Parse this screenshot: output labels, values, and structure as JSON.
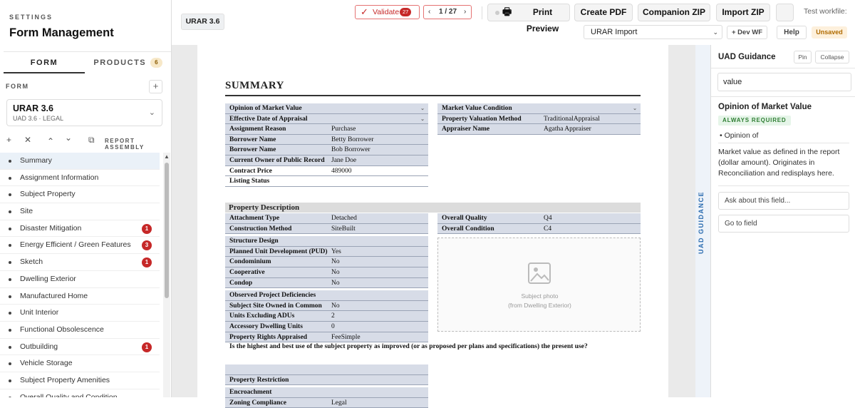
{
  "sidebar": {
    "settings_label": "SETTINGS",
    "title": "Form Management",
    "tabs": [
      {
        "label": "FORM"
      },
      {
        "label": "PRODUCTS",
        "count": "6"
      }
    ],
    "form_label": "FORM",
    "add_icon": "+",
    "form_select": {
      "name": "URAR 3.6",
      "sub": "UAD 3.6 · LEGAL",
      "chevron": "⌄"
    },
    "toolbar": {
      "add": "+",
      "remove": "✕",
      "up": "⌃",
      "down": "⌄",
      "copy": "⧉",
      "report_label": "REPORT ASSEMBLY"
    },
    "scroll_up": "▲",
    "items": [
      {
        "label": "Summary",
        "badge": ""
      },
      {
        "label": "Assignment Information",
        "badge": ""
      },
      {
        "label": "Subject Property",
        "badge": ""
      },
      {
        "label": "Site",
        "badge": ""
      },
      {
        "label": "Disaster Mitigation",
        "badge": "1"
      },
      {
        "label": "Energy Efficient / Green Features",
        "badge": "3"
      },
      {
        "label": "Sketch",
        "badge": "1"
      },
      {
        "label": "Dwelling Exterior",
        "badge": ""
      },
      {
        "label": "Manufactured Home",
        "badge": ""
      },
      {
        "label": "Unit Interior",
        "badge": ""
      },
      {
        "label": "Functional Obsolescence",
        "badge": ""
      },
      {
        "label": "Outbuilding",
        "badge": "1"
      },
      {
        "label": "Vehicle Storage",
        "badge": ""
      },
      {
        "label": "Subject Property Amenities",
        "badge": ""
      },
      {
        "label": "Overall Quality and Condition",
        "badge": ""
      }
    ]
  },
  "topbar": {
    "active_tab": "URAR 3.6",
    "validate": {
      "label": "Validate",
      "count": "27"
    },
    "pager": {
      "prev": "‹",
      "text": "1 / 27",
      "next": "›"
    },
    "print_preview": "Print Preview",
    "create_pdf": "Create PDF",
    "companion_zip": "Companion ZIP",
    "import_zip": "Import ZIP",
    "test_workflow": "Test workfile:",
    "import_select": {
      "value": "URAR Import",
      "chevron": "⌄"
    },
    "dev_wf": "+ Dev WF",
    "help": "Help",
    "status": "Unsaved"
  },
  "document": {
    "summary_title": "SUMMARY",
    "left_block": [
      {
        "k": "Opinion of Market Value",
        "v": "",
        "shade": true,
        "dd": true
      },
      {
        "k": "Effective Date of Appraisal",
        "v": "",
        "shade": true,
        "dd": true
      },
      {
        "k": "Assignment Reason",
        "v": "Purchase",
        "shade": true
      },
      {
        "k": "Borrower Name",
        "v": "Betty Borrower",
        "shade": true
      },
      {
        "k": "Borrower Name",
        "v": "Bob Borrower",
        "shade": true
      },
      {
        "k": "Current Owner of Public Record",
        "v": "Jane Doe",
        "shade": true
      },
      {
        "k": "Contract Price",
        "v": "489000",
        "shade": false
      },
      {
        "k": "Listing Status",
        "v": "",
        "shade": false
      }
    ],
    "right_block": [
      {
        "k": "Market Value Condition",
        "v": "",
        "shade": true,
        "dd": true
      },
      {
        "k": "Property Valuation Method",
        "v": "TraditionalAppraisal",
        "shade": true
      },
      {
        "k": "Appraiser Name",
        "v": "Agatha Appraiser",
        "shade": true
      }
    ],
    "section_title": "Property Description",
    "pd_left": [
      {
        "k": "Attachment Type",
        "v": "Detached",
        "shade": true
      },
      {
        "k": "Construction Method",
        "v": "SiteBuilt",
        "shade": true
      },
      {
        "gap": true
      },
      {
        "k": "Structure Design",
        "v": "",
        "shade": true
      },
      {
        "k": "Planned Unit Development (PUD)",
        "v": "Yes",
        "shade": true
      },
      {
        "k": "Condominium",
        "v": "No",
        "shade": true
      },
      {
        "k": "Cooperative",
        "v": "No",
        "shade": true
      },
      {
        "k": "Condop",
        "v": "No",
        "shade": true
      },
      {
        "gap": true
      },
      {
        "k": "Observed Project Deficiencies",
        "v": "",
        "shade": true
      },
      {
        "k": "Subject Site Owned in Common",
        "v": "No",
        "shade": true
      },
      {
        "k": "Units Excluding ADUs",
        "v": "2",
        "shade": true
      },
      {
        "k": "Accessory Dwelling Units",
        "v": "0",
        "shade": true
      },
      {
        "k": "Property Rights Appraised",
        "v": "FeeSimple",
        "shade": true
      }
    ],
    "pd_right": [
      {
        "k": "Overall Quality",
        "v": "Q4",
        "shade": true
      },
      {
        "k": "Overall Condition",
        "v": "C4",
        "shade": true
      }
    ],
    "photo_caption_1": "Subject photo",
    "photo_caption_2": "(from Dwelling Exterior)",
    "long_question": "Is the highest and best use of the subject property as improved (or as proposed per plans and specifications) the present use?",
    "tail_rows": [
      {
        "k": "",
        "v": "",
        "shade": true
      },
      {
        "k": "Property Restriction",
        "v": "",
        "shade": true
      },
      {
        "gap": true
      },
      {
        "k": "Encroachment",
        "v": "",
        "shade": true
      },
      {
        "k": "Zoning Compliance",
        "v": "Legal",
        "shade": true
      }
    ]
  },
  "guidance": {
    "strip_label": "UAD GUIDANCE",
    "title": "UAD Guidance",
    "pin": "Pin",
    "collapse": "Collapse",
    "search_value": "value",
    "field_title": "Opinion of Market Value",
    "requirement": "ALWAYS REQUIRED",
    "bullet": "• Opinion of",
    "description": "Market value as defined in the report (dollar amount). Originates in Reconciliation and redisplays here.",
    "ask_placeholder": "Ask about this field...",
    "go_to_field": "Go to field"
  },
  "colors": {
    "accent_red": "#c62828",
    "doc_shade": "#d7dce7",
    "guidance_blue": "#2b6cb0"
  }
}
